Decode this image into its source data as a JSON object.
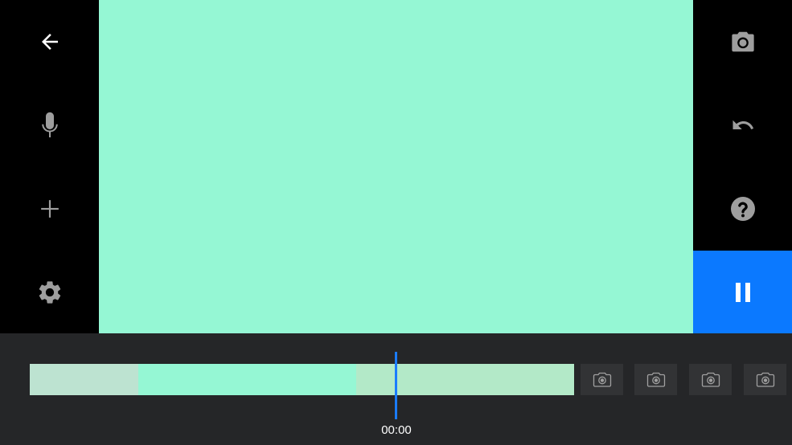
{
  "colors": {
    "preview": "#95f7d4",
    "accent": "#0b79ff",
    "bottom_bar": "#252628",
    "segments": [
      "#bde3d1",
      "#95f7d4",
      "#b3e9c8"
    ],
    "thumb_bg": "#323335"
  },
  "left_toolbar": {
    "buttons": [
      {
        "name": "back",
        "icon": "arrow-left-icon"
      },
      {
        "name": "voiceover",
        "icon": "microphone-icon"
      },
      {
        "name": "add",
        "icon": "plus-icon"
      },
      {
        "name": "settings",
        "icon": "gear-icon"
      }
    ]
  },
  "right_toolbar": {
    "buttons": [
      {
        "name": "capture",
        "icon": "camera-icon"
      },
      {
        "name": "undo",
        "icon": "undo-icon"
      },
      {
        "name": "help",
        "icon": "question-icon"
      },
      {
        "name": "pause",
        "icon": "pause-icon",
        "active": true
      }
    ]
  },
  "timeline": {
    "current_time": "00:00",
    "segments": 3,
    "empty_slots": 4,
    "slot_icon": "camera-outline-icon"
  }
}
